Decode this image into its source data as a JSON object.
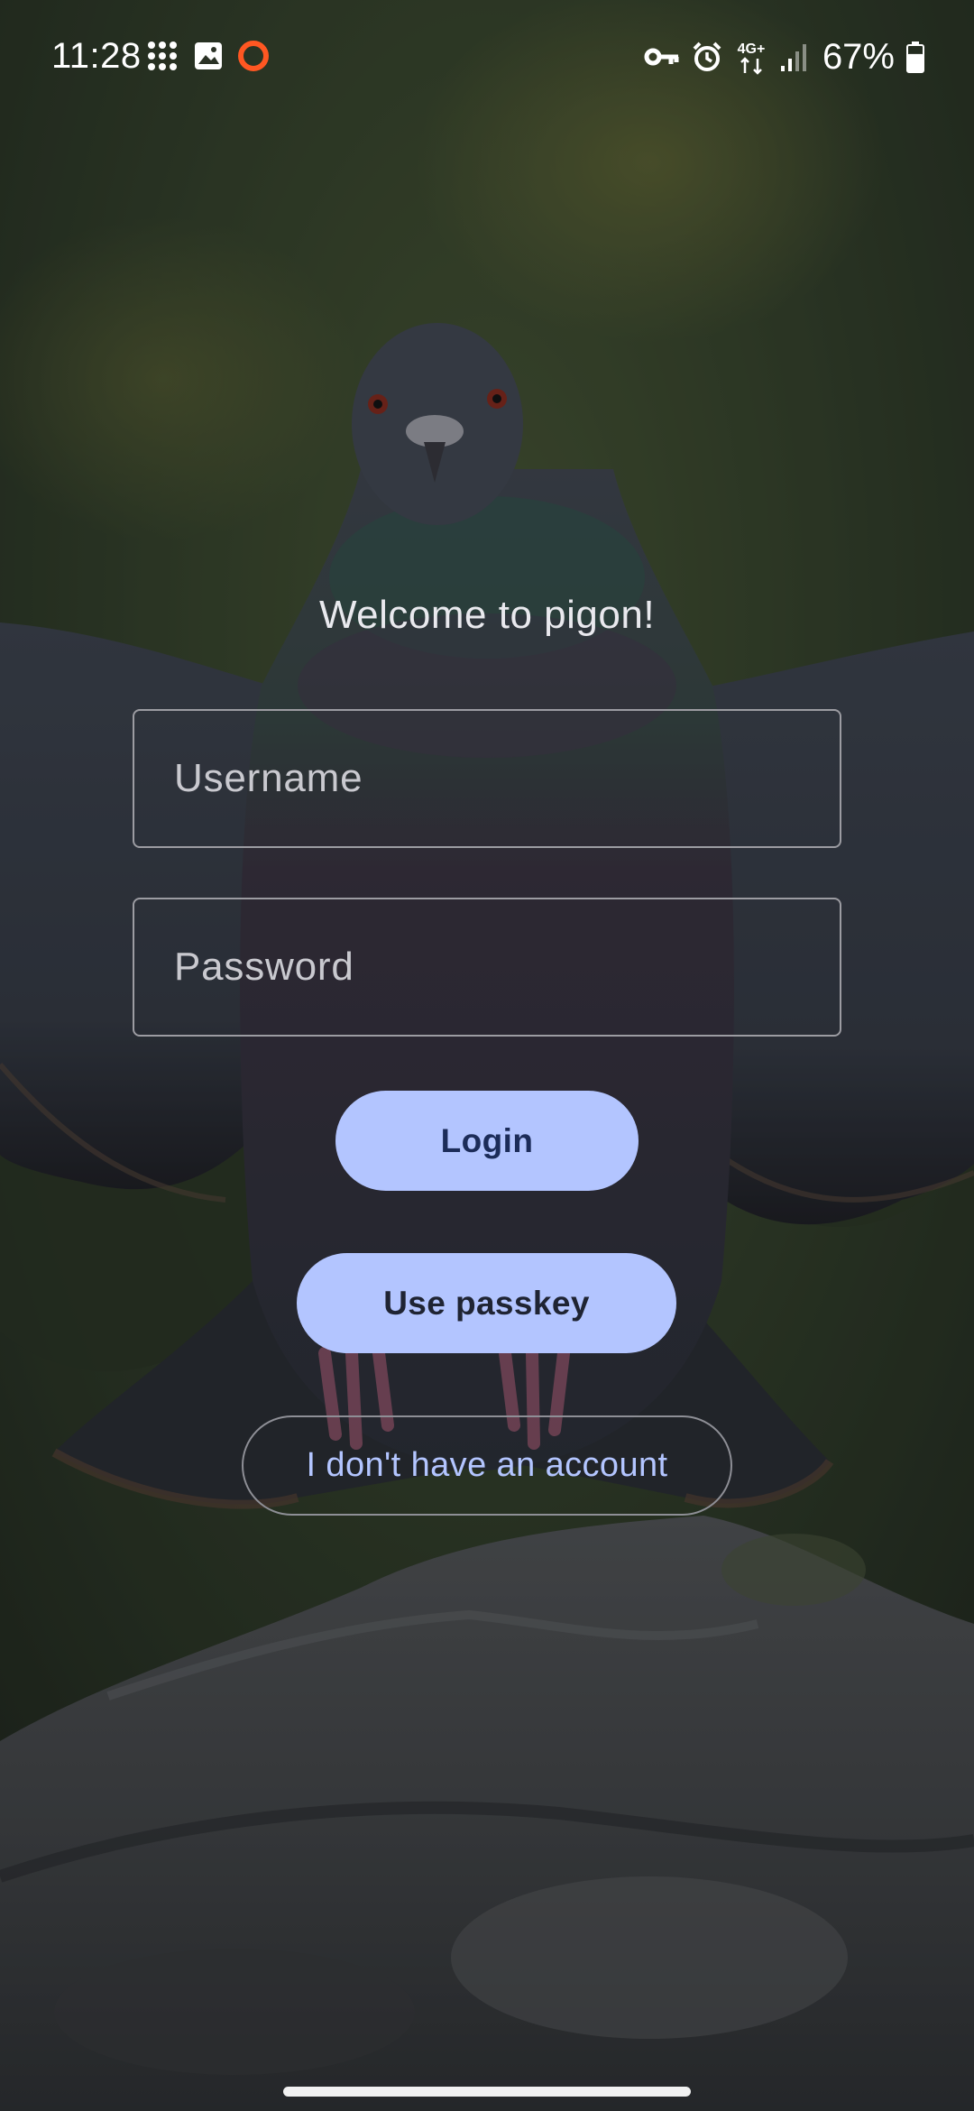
{
  "status_bar": {
    "time": "11:28",
    "left_icons": [
      "grid-dots-icon",
      "gallery-icon",
      "ring-notification-icon"
    ],
    "right_icons": [
      "vpn-key-icon",
      "alarm-icon",
      "network-4g-plus-icon",
      "signal-icon",
      "battery-icon"
    ],
    "network_label": "4G+",
    "battery_percent": "67%",
    "battery_level": 0.67
  },
  "login": {
    "welcome_text": "Welcome to pigon!",
    "username_placeholder": "Username",
    "username_value": "",
    "password_placeholder": "Password",
    "password_value": "",
    "login_label": "Login",
    "passkey_label": "Use passkey",
    "no_account_label": "I don't have an account"
  },
  "colors": {
    "accent": "#b3c5ff",
    "on_accent": "#1c2c59",
    "outline": "#9c9ca2",
    "text": "#e9e9ee"
  }
}
